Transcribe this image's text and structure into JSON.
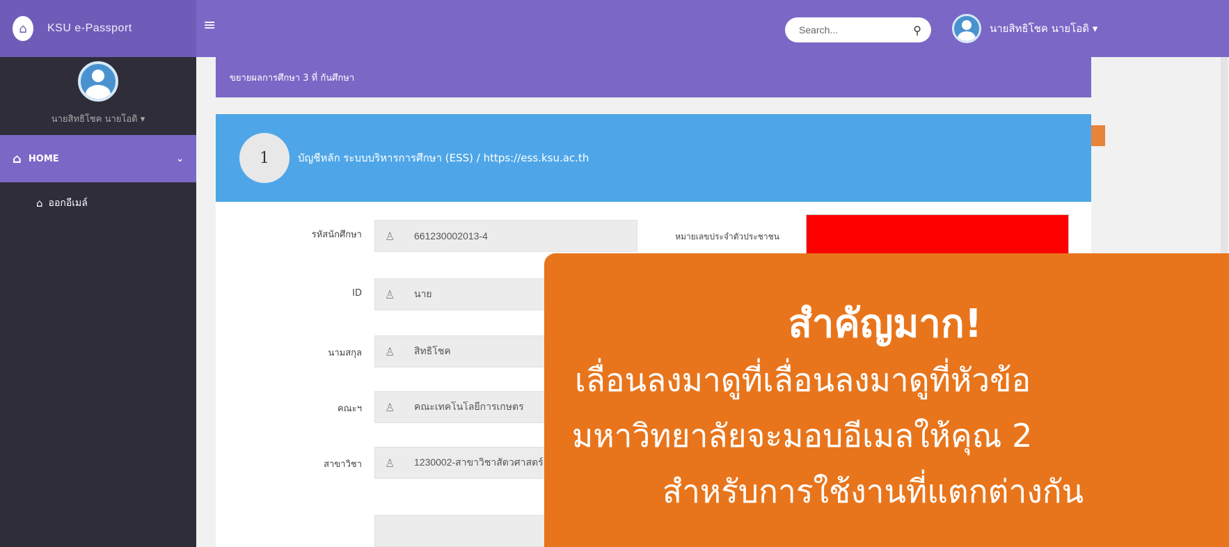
{
  "header": {
    "brand": "KSU e-Passport",
    "search_placeholder": "Search...",
    "user_name": "นายสิทธิโชค นายโอดิ ▾"
  },
  "sidebar": {
    "user_name": "นายสิทธิโชค นายโอดิ ▾",
    "home_label": "HOME",
    "sub_item": "ออกอีเมล์"
  },
  "breadcrumb": "ขยายผลการศึกษา 3 ที่ กันศึกษา",
  "card": {
    "step": "1",
    "title": "บัญชีหลัก ระบบบริหารการศึกษา (ESS) / https://ess.ksu.ac.th",
    "id_card_label": "หมายเลขประจำตัวประชาชน",
    "fields": [
      {
        "label": "รหัสนักศึกษา",
        "value": "661230002013-4"
      },
      {
        "label": "ID",
        "value": "นาย"
      },
      {
        "label": "นามสกุล",
        "value": "สิทธิโชค"
      },
      {
        "label": "คณะฯ",
        "value": "คณะเทคโนโลยีการเกษตร"
      },
      {
        "label": "สาขาวิชา",
        "value": "1230002-สาขาวิชาสัตวศาสตร์"
      }
    ]
  },
  "overlay": {
    "title": "สำคัญมาก!",
    "line1": "เลื่อนลงมาดูที่เลื่อนลงมาดูที่หัวข้อ",
    "line2": "มหาวิทยาลัยจะมอบอีเมลให้คุณ 2",
    "line3": "สำหรับการใช้งานที่แตกต่างกัน"
  },
  "colors": {
    "topbar": "#7b67c6",
    "sidebar": "#2f2d3a",
    "card_head": "#4ea6e8",
    "overlay": "#e8751c"
  }
}
